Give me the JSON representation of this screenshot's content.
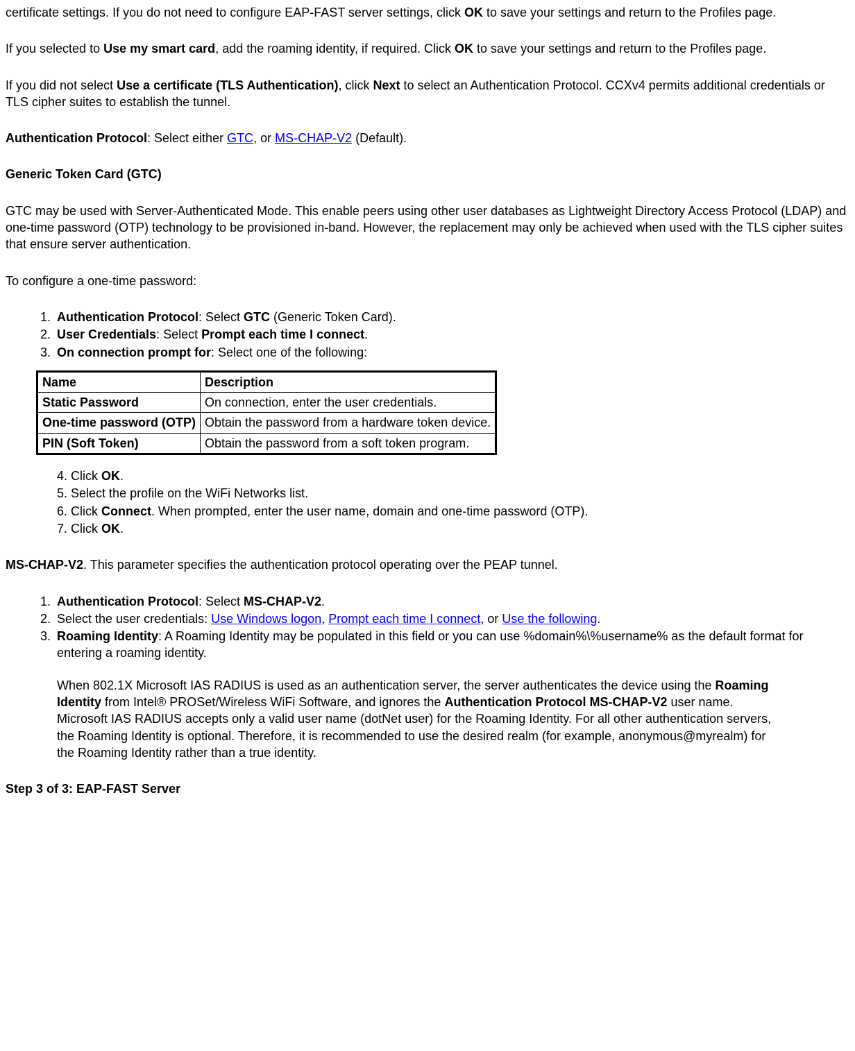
{
  "p1_a": "certificate settings. If you do not need to configure EAP-FAST server settings, click ",
  "p1_b": "OK",
  "p1_c": " to save your settings and return to the Profiles page.",
  "p2_a": "If you selected to ",
  "p2_b": "Use my smart card",
  "p2_c": ", add the roaming identity, if required. Click ",
  "p2_d": "OK",
  "p2_e": " to save your settings and return to the Profiles page.",
  "p3_a": "If you did not select ",
  "p3_b": "Use a certificate (TLS Authentication)",
  "p3_c": ", click ",
  "p3_d": "Next",
  "p3_e": " to select an Authentication Protocol. CCXv4 permits additional credentials or TLS cipher suites to establish the tunnel.",
  "p4_a": "Authentication Protocol",
  "p4_b": ": Select either ",
  "p4_link1": "GTC",
  "p4_c": ", or ",
  "p4_link2": "MS-CHAP-V2",
  "p4_d": " (Default).",
  "h_gtc": "Generic Token Card (GTC)",
  "p5": "GTC may be used with Server-Authenticated Mode. This enable peers using other user databases as Lightweight Directory Access Protocol (LDAP) and one-time password (OTP) technology to be provisioned in-band. However, the replacement may only be achieved when used with the TLS cipher suites that ensure server authentication.",
  "p6": "To configure a one-time password:",
  "ol1": {
    "i1_a": "Authentication Protocol",
    "i1_b": ": Select ",
    "i1_c": "GTC",
    "i1_d": " (Generic Token Card).",
    "i2_a": "User Credentials",
    "i2_b": ": Select ",
    "i2_c": "Prompt each time I connect",
    "i2_d": ".",
    "i3_a": "On connection prompt for",
    "i3_b": ": Select one of the following:"
  },
  "table": {
    "h1": "Name",
    "h2": "Description",
    "r1c1": "Static Password",
    "r1c2": "On connection, enter the user credentials.",
    "r2c1": "One-time password (OTP)",
    "r2c2": "Obtain the password from a hardware token device.",
    "r3c1": "PIN (Soft Token)",
    "r3c2": "Obtain the password from a soft token program."
  },
  "ol2": {
    "i4_a": "Click ",
    "i4_b": "OK",
    "i4_c": ".",
    "i5": "Select the profile on the WiFi Networks list.",
    "i6_a": "Click ",
    "i6_b": "Connect",
    "i6_c": ". When prompted, enter the user name, domain and one-time password (OTP).",
    "i7_a": "Click ",
    "i7_b": "OK",
    "i7_c": "."
  },
  "p7_a": "MS-CHAP-V2",
  "p7_b": ". This parameter specifies the authentication protocol operating over the PEAP tunnel.",
  "ol3": {
    "i1_a": "Authentication Protocol",
    "i1_b": ": Select ",
    "i1_c": "MS-CHAP-V2",
    "i1_d": ".",
    "i2_a": "Select the user credentials: ",
    "i2_link1": "Use Windows logon",
    "i2_b": ", ",
    "i2_link2": "Prompt each time I connect",
    "i2_c": ", or ",
    "i2_link3": "Use the following",
    "i2_d": ".",
    "i3_a": "Roaming Identity",
    "i3_b": ": A Roaming Identity may be populated in this field or you can use %domain%\\%username% as the default format for entering a roaming identity.",
    "i3_p2_a": "When 802.1X Microsoft IAS RADIUS is used as an authentication server, the server authenticates the device using the ",
    "i3_p2_b": "Roaming Identity",
    "i3_p2_c": " from Intel® PROSet/Wireless WiFi Software, and ignores the ",
    "i3_p2_d": "Authentication Protocol MS-CHAP-V2",
    "i3_p2_e": " user name. Microsoft IAS RADIUS accepts only a valid user name (dotNet user) for the Roaming Identity. For all other authentication servers, the Roaming Identity is optional. Therefore, it is recommended to use the desired realm (for example, anonymous@myrealm) for the Roaming Identity rather than a true identity."
  },
  "h_step3": "Step 3 of 3: EAP-FAST Server"
}
